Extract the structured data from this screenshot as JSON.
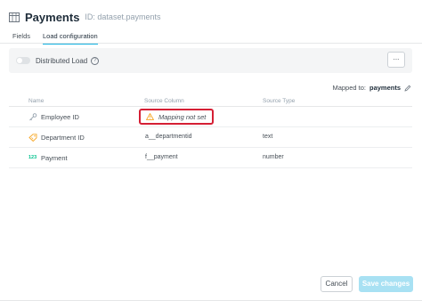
{
  "header": {
    "title": "Payments",
    "subtitle": "ID: dataset.payments"
  },
  "tabs": [
    {
      "label": "Fields",
      "active": false
    },
    {
      "label": "Load configuration",
      "active": true
    }
  ],
  "distributed_load": {
    "label": "Distributed Load",
    "help_icon": "?",
    "enabled": false,
    "more_label": "..."
  },
  "mapped_to": {
    "label": "Mapped to:",
    "value": "payments"
  },
  "table": {
    "columns": [
      "Name",
      "Source Column",
      "Source Type"
    ],
    "rows": [
      {
        "icon": "key-icon",
        "name": "Employee ID",
        "source_column": "Mapping not set",
        "source_type": "",
        "warning": true
      },
      {
        "icon": "label-icon",
        "name": "Department ID",
        "source_column": "a__departmentid",
        "source_type": "text",
        "warning": false
      },
      {
        "icon": "number-icon",
        "icon_text": "123",
        "name": "Payment",
        "source_column": "f__payment",
        "source_type": "number",
        "warning": false
      }
    ]
  },
  "footer": {
    "cancel_label": "Cancel",
    "save_label": "Save changes"
  },
  "colors": {
    "accent": "#14b2e2",
    "warning_border": "#d51f34",
    "key_icon": "#94a1ad",
    "label_icon": "#f6a623",
    "number_icon": "#00c18d",
    "save_button_disabled": "#a8e1f3"
  }
}
